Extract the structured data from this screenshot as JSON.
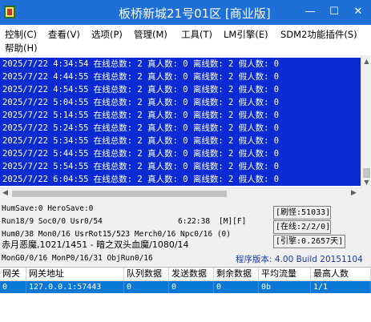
{
  "window": {
    "title": "板桥新城21号01区 [商业版]",
    "minimize_symbol": "—",
    "maximize_symbol": "☐",
    "close_symbol": "✕",
    "accent_color": "#1e6fd6"
  },
  "menu": {
    "items": [
      "控制(C)",
      "查看(V)",
      "选项(P)",
      "管理(M)",
      "工具(T)",
      "LM引擎(E)",
      "SDM2功能插件(S)",
      "帮助(H)"
    ]
  },
  "log": {
    "highlight_color": "#0a2bd4",
    "lines": [
      "2025/7/22 4:34:54 在线总数: 2 真人数: 0 离线数: 2 假人数: 0",
      "2025/7/22 4:44:55 在线总数: 2 真人数: 0 离线数: 2 假人数: 0",
      "2025/7/22 4:54:55 在线总数: 2 真人数: 0 离线数: 2 假人数: 0",
      "2025/7/22 5:04:55 在线总数: 2 真人数: 0 离线数: 2 假人数: 0",
      "2025/7/22 5:14:55 在线总数: 2 真人数: 0 离线数: 2 假人数: 0",
      "2025/7/22 5:24:55 在线总数: 2 真人数: 0 离线数: 2 假人数: 0",
      "2025/7/22 5:34:55 在线总数: 2 真人数: 0 离线数: 2 假人数: 0",
      "2025/7/22 5:44:55 在线总数: 2 真人数: 0 离线数: 2 假人数: 0",
      "2025/7/22 5:54:55 在线总数: 2 真人数: 0 离线数: 2 假人数: 0",
      "2025/7/22 6:04:55 在线总数: 2 真人数: 0 离线数: 2 假人数: 0"
    ]
  },
  "status": {
    "save_line": "HumSave:0 HeroSave:0",
    "run_line": "Run18/9 Soc0/0 Usr0/54",
    "time": "6:22:38",
    "flags": "[M][F]",
    "hum_line": "Hum0/38 Mon0/16 UsrRot15/523 Merch0/16 Npc0/16 (0)",
    "monster_line": "赤月恶魔,1021/1451 - 暗之双头血魔/1080/14",
    "mong_line": "MonG0/0/16 MonP0/16/31 ObjRun0/16",
    "refresh_box": "[刷怪:51033]",
    "online_box": "[在线:2/2/0]",
    "engine_box": "[引擎:0.2657天]",
    "version": "程序版本: 4.00 Build 20151104"
  },
  "table": {
    "headers": [
      "网关",
      "网关地址",
      "队列数据",
      "发送数据",
      "剩余数据",
      "平均流量",
      "最高人数"
    ],
    "rows": [
      [
        "0",
        "127.0.0.1:57443",
        "0",
        "0",
        "0",
        "0b",
        "1/1"
      ]
    ],
    "selected_color": "#0a78d7"
  }
}
